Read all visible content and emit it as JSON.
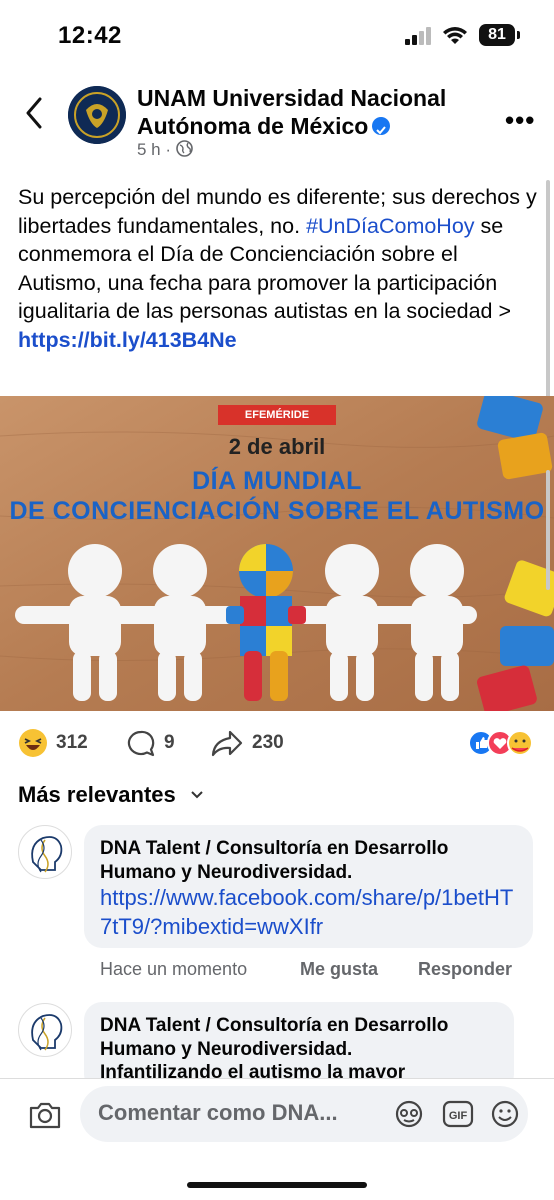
{
  "status_bar": {
    "time": "12:42",
    "battery": "81"
  },
  "header": {
    "page_name": "UNAM Universidad Nacional Autónoma de México",
    "time_ago": "5 h ·"
  },
  "post": {
    "text_1": "Su percepción del mundo es diferente; sus derechos y libertades fundamentales, no.",
    "hashtag": "#UnDíaComoHoy",
    "text_2": " se conmemora el Día de Concienciación sobre el Autismo, una fecha para promover la participación igualitaria de las personas autistas en la sociedad >",
    "link": "https://bit.ly/413B4Ne"
  },
  "image": {
    "badge": "EFEMÉRIDE",
    "date": "2 de abril",
    "headline_1": "DÍA MUNDIAL",
    "headline_2": "DE CONCIENCIACIÓN SOBRE EL AUTISMO"
  },
  "stats": {
    "reactions": "312",
    "comments": "9",
    "shares": "230"
  },
  "sort_label": "Más relevantes",
  "comments": [
    {
      "author": "DNA Talent / Consultoría en Desarrollo Humano y Neurodiversidad.",
      "text": "https://www.facebook.com/share/p/1betHT7tT9/?mibextid=wwXIfr",
      "time": "Hace un momento",
      "like": "Me gusta",
      "reply": "Responder"
    },
    {
      "author": "DNA Talent / Consultoría en Desarrollo Humano y Neurodiversidad.",
      "text": "Infantilizando el autismo la mayor"
    }
  ],
  "composer": {
    "placeholder": "Comentar como DNA..."
  }
}
